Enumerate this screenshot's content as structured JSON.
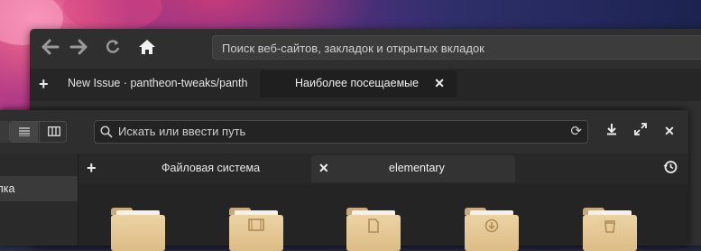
{
  "browser": {
    "back_icon": "arrow-left-icon",
    "forward_icon": "arrow-right-icon",
    "reload_icon": "reload-icon",
    "home_icon": "home-icon",
    "search_placeholder": "Поиск веб-сайтов, закладок и открытых вкладок",
    "tabs": [
      {
        "label": "New Issue · pantheon-tweaks/panth"
      },
      {
        "label": "Наиболее посещаемые",
        "active": true
      }
    ]
  },
  "files": {
    "view_modes": [
      "list-view-icon",
      "column-view-icon"
    ],
    "path_placeholder": "Искать или ввести путь",
    "sidebar": {
      "items": [
        {
          "label": "апка"
        }
      ]
    },
    "tabs": [
      {
        "label": "Файловая система"
      },
      {
        "label": "elementary",
        "active": true
      }
    ],
    "folders": [
      {
        "type": "folder",
        "icon": "folder-icon"
      },
      {
        "type": "videos",
        "icon": "film-icon"
      },
      {
        "type": "documents",
        "icon": "document-icon"
      },
      {
        "type": "downloads",
        "icon": "download-icon"
      },
      {
        "type": "trash",
        "icon": "trash-icon"
      }
    ]
  }
}
